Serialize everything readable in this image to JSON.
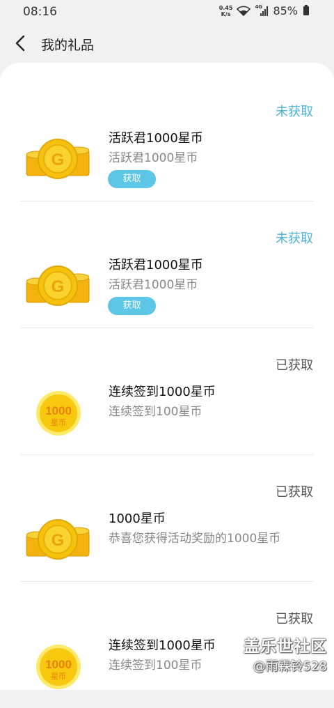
{
  "status_bar": {
    "time": "08:16",
    "net_speed_value": "0.45",
    "net_speed_unit": "K/s",
    "network_type": "4G",
    "battery": "85%"
  },
  "header": {
    "title": "我的礼品"
  },
  "items": [
    {
      "status": "未获取",
      "title": "活跃君1000星币",
      "subtitle": "活跃君1000星币",
      "button": "获取",
      "icon": "gold-coin-stack-icon"
    },
    {
      "status": "未获取",
      "title": "活跃君1000星币",
      "subtitle": "活跃君1000星币",
      "button": "获取",
      "icon": "gold-coin-stack-icon"
    },
    {
      "status": "已获取",
      "title": "连续签到1000星币",
      "subtitle": "连续签到100星币",
      "icon": "1000-star-coin-icon",
      "icon_value": "1000",
      "icon_unit": "星币"
    },
    {
      "status": "已获取",
      "title": "1000星币",
      "subtitle": "恭喜您获得活动奖励的1000星币",
      "icon": "gold-coin-stack-icon"
    },
    {
      "status": "已获取",
      "title": "连续签到1000星币",
      "subtitle": "连续签到100星币",
      "icon": "1000-star-coin-icon",
      "icon_value": "1000",
      "icon_unit": "星币"
    }
  ],
  "watermark": {
    "line1": "盖乐世社区",
    "line2": "@雨霖铃528"
  },
  "colors": {
    "accent": "#49b4d3",
    "button": "#5bc6e6",
    "coin": "#f6c20c"
  }
}
